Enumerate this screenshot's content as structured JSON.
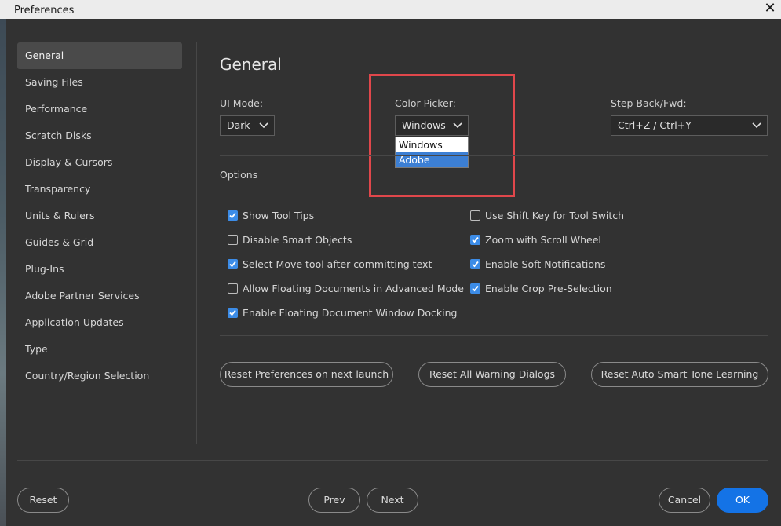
{
  "window": {
    "title": "Preferences",
    "close_glyph": "✕"
  },
  "sidebar": {
    "items": [
      {
        "label": "General",
        "active": true
      },
      {
        "label": "Saving Files"
      },
      {
        "label": "Performance"
      },
      {
        "label": "Scratch Disks"
      },
      {
        "label": "Display & Cursors"
      },
      {
        "label": "Transparency"
      },
      {
        "label": "Units & Rulers"
      },
      {
        "label": "Guides & Grid"
      },
      {
        "label": "Plug-Ins"
      },
      {
        "label": "Adobe Partner Services"
      },
      {
        "label": "Application Updates"
      },
      {
        "label": "Type"
      },
      {
        "label": "Country/Region Selection"
      }
    ]
  },
  "main": {
    "title": "General",
    "ui_mode": {
      "label": "UI Mode:",
      "value": "Dark"
    },
    "color_picker": {
      "label": "Color Picker:",
      "value": "Windows",
      "options": [
        "Windows",
        "Adobe"
      ],
      "highlighted_option": "Adobe"
    },
    "step_back": {
      "label": "Step Back/Fwd:",
      "value": "Ctrl+Z / Ctrl+Y"
    },
    "options_label": "Options",
    "options_left": [
      {
        "label": "Show Tool Tips",
        "checked": true
      },
      {
        "label": "Disable Smart Objects",
        "checked": false
      },
      {
        "label": "Select Move tool after committing text",
        "checked": true
      },
      {
        "label": "Allow Floating Documents in Advanced Mode",
        "checked": false
      },
      {
        "label": "Enable Floating Document Window Docking",
        "checked": true
      }
    ],
    "options_right": [
      {
        "label": "Use Shift Key for Tool Switch",
        "checked": false
      },
      {
        "label": "Zoom with Scroll Wheel",
        "checked": true
      },
      {
        "label": "Enable Soft Notifications",
        "checked": true
      },
      {
        "label": "Enable Crop Pre-Selection",
        "checked": true
      }
    ],
    "reset_buttons": {
      "reset_prefs": "Reset Preferences on next launch",
      "reset_warnings": "Reset All Warning Dialogs",
      "reset_smart_tone": "Reset Auto Smart Tone Learning"
    }
  },
  "footer": {
    "reset": "Reset",
    "prev": "Prev",
    "next": "Next",
    "cancel": "Cancel",
    "ok": "OK"
  },
  "colors": {
    "background": "#323232",
    "accent": "#1473e6",
    "checkbox": "#3c8ce7",
    "highlight_box": "#e0474b"
  }
}
